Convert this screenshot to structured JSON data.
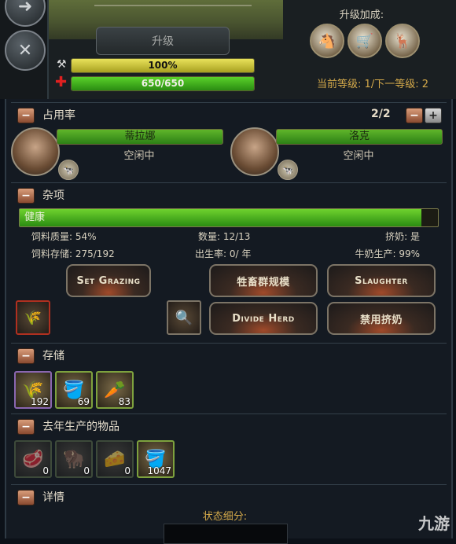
{
  "top": {
    "upgrade_button": "升级",
    "upgrade_bonus_label": "升级加成:",
    "hammer_bar_text": "100%",
    "hammer_bar_fill": 1.0,
    "health_bar_text": "650/650",
    "health_bar_fill": 1.0,
    "level_text": "当前等级: 1/下一等级: 2",
    "bonus_icons": [
      "horse-icon",
      "cart-icon",
      "deer-plus-icon"
    ]
  },
  "occupancy": {
    "title": "占用率",
    "count": "2/2",
    "workers": [
      {
        "name": "蒂拉娜",
        "status": "空闲中"
      },
      {
        "name": "洛克",
        "status": "空闲中"
      }
    ]
  },
  "misc": {
    "title": "杂项",
    "health_label": "健康",
    "health_fill": 0.96,
    "stats": {
      "feed_quality": "饲料质量: 54%",
      "quantity": "数量: 12/13",
      "milking": "挤奶: 是",
      "feed_storage": "饲料存储: 275/192",
      "birth_rate": "出生率: 0/ 年",
      "milk_production": "牛奶生产: 99%"
    },
    "buttons": {
      "set_grazing": "Set Grazing",
      "herd_size": "牲畜群规模",
      "slaughter": "Slaughter",
      "divide_herd": "Divide Herd",
      "disable_milking": "禁用挤奶"
    }
  },
  "storage": {
    "title": "存储",
    "items": [
      {
        "icon": "wheat-icon",
        "count": "192"
      },
      {
        "icon": "milk-bucket-icon",
        "count": "69"
      },
      {
        "icon": "vegetables-icon",
        "count": "83"
      }
    ]
  },
  "last_year": {
    "title": "去年生产的物品",
    "items": [
      {
        "icon": "meat-icon",
        "count": "0"
      },
      {
        "icon": "hide-icon",
        "count": "0"
      },
      {
        "icon": "cheese-icon",
        "count": "0"
      },
      {
        "icon": "milk-bucket-icon",
        "count": "1047"
      }
    ]
  },
  "details": {
    "title": "详情",
    "subtitle": "状态细分:"
  },
  "watermark": "九游"
}
